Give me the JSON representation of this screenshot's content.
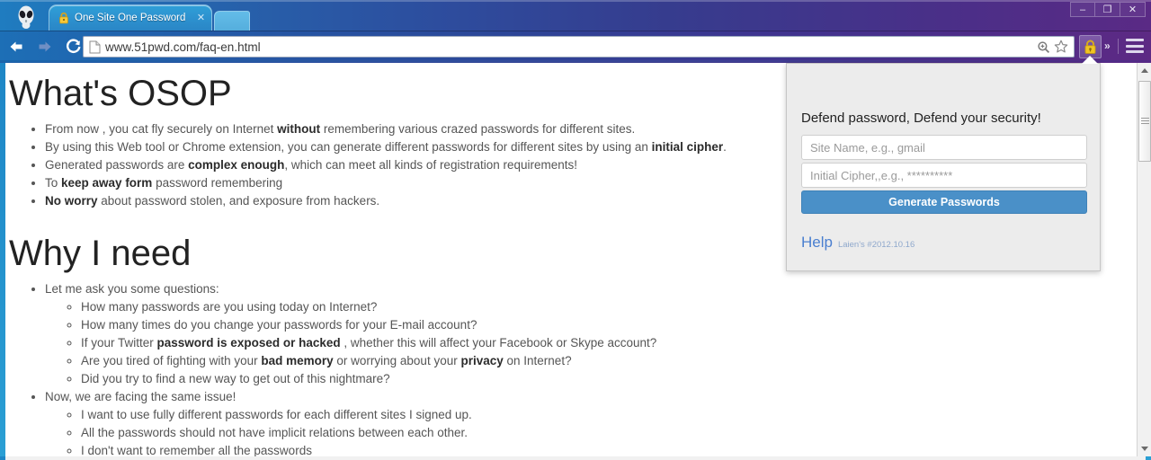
{
  "window": {
    "controls": {
      "minimize": "–",
      "maximize": "❐",
      "close": "✕"
    }
  },
  "tabstrip": {
    "avatar_icon": "alien-avatar-icon",
    "tabs": [
      {
        "title": "One Site One Password",
        "favicon": "lock-icon",
        "close": "✕",
        "active": true
      }
    ],
    "new_tab_label": ""
  },
  "toolbar": {
    "back_icon": "back-arrow-icon",
    "forward_icon": "forward-arrow-icon",
    "reload_icon": "reload-icon",
    "url": "www.51pwd.com/faq-en.html",
    "page_icon": "page-document-icon",
    "zoom_icon": "magnifier-icon",
    "bookmark_icon": "star-icon",
    "extension_icon": "padlock-icon",
    "overflow_label": "»",
    "menu_icon": "hamburger-menu-icon"
  },
  "page": {
    "sections": [
      {
        "heading": "What's OSOP",
        "bullets": [
          [
            {
              "t": "From now , you cat fly securely on Internet ",
              "b": false
            },
            {
              "t": "without",
              "b": true
            },
            {
              "t": " remembering various crazed passwords for different sites.",
              "b": false
            }
          ],
          [
            {
              "t": "By using this Web tool or Chrome extension, you can generate different passwords for different sites by using an ",
              "b": false
            },
            {
              "t": "initial cipher",
              "b": true
            },
            {
              "t": ".",
              "b": false
            }
          ],
          [
            {
              "t": "Generated passwords are ",
              "b": false
            },
            {
              "t": "complex enough",
              "b": true
            },
            {
              "t": ", which can meet all kinds of registration requirements!",
              "b": false
            }
          ],
          [
            {
              "t": "To ",
              "b": false
            },
            {
              "t": "keep away form",
              "b": true
            },
            {
              "t": " password remembering",
              "b": false
            }
          ],
          [
            {
              "t": "No worry",
              "b": true
            },
            {
              "t": " about password stolen, and exposure from hackers.",
              "b": false
            }
          ]
        ]
      },
      {
        "heading": "Why I need",
        "groups": [
          {
            "lead": [
              {
                "t": "Let me ask you some questions:",
                "b": false
              }
            ],
            "items": [
              [
                {
                  "t": "How many passwords are you using today on Internet?",
                  "b": false
                }
              ],
              [
                {
                  "t": "How many times do you change your passwords for your E-mail account?",
                  "b": false
                }
              ],
              [
                {
                  "t": "If your Twitter ",
                  "b": false
                },
                {
                  "t": "password is exposed or hacked",
                  "b": true
                },
                {
                  "t": " , whether this will affect your Facebook or Skype account?",
                  "b": false
                }
              ],
              [
                {
                  "t": "Are you tired of fighting with your ",
                  "b": false
                },
                {
                  "t": "bad memory",
                  "b": true
                },
                {
                  "t": " or worrying about your ",
                  "b": false
                },
                {
                  "t": "privacy",
                  "b": true
                },
                {
                  "t": " on Internet?",
                  "b": false
                }
              ],
              [
                {
                  "t": "Did you try to find a new way to get out of this nightmare?",
                  "b": false
                }
              ]
            ]
          },
          {
            "lead": [
              {
                "t": "Now, we are facing the same issue!",
                "b": false
              }
            ],
            "items": [
              [
                {
                  "t": "I want to use fully different passwords for each different sites I signed up.",
                  "b": false
                }
              ],
              [
                {
                  "t": "All the passwords should not have implicit relations between each other.",
                  "b": false
                }
              ],
              [
                {
                  "t": "I don't want to remember all the passwords",
                  "b": false
                }
              ]
            ]
          }
        ]
      }
    ]
  },
  "popup": {
    "heading": "Defend password, Defend your security!",
    "site_name_value": "",
    "site_name_placeholder": "Site Name, e.g., gmail",
    "initial_cipher_value": "",
    "initial_cipher_placeholder": "Initial Cipher,,e.g., **********",
    "generate_label": "Generate Passwords",
    "help_label": "Help",
    "version_label": "Laien's #2012.10.16"
  },
  "colors": {
    "accent_blue": "#4a90c8",
    "link_blue": "#4a7fd0",
    "tab_blue": "#2d93d0",
    "frame_cyan": "#1e86c6",
    "titlebar_purple": "#5b2a86"
  }
}
